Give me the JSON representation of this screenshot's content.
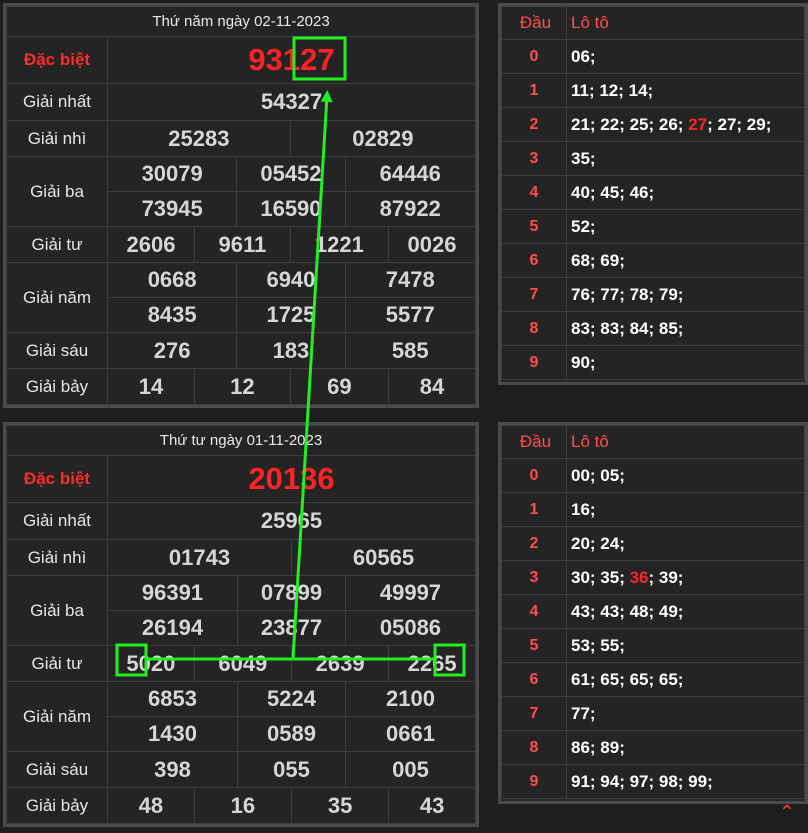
{
  "labels": {
    "special": "Đặc biệt",
    "first": "Giải nhất",
    "second": "Giải nhì",
    "third": "Giải ba",
    "fourth": "Giải tư",
    "fifth": "Giải năm",
    "sixth": "Giải sáu",
    "seventh": "Giải bảy",
    "dau": "Đầu",
    "loto": "Lô tô"
  },
  "draws": [
    {
      "date": "Thứ năm ngày 02-11-2023",
      "special": "93127",
      "first": "54327",
      "second": [
        "25283",
        "02829"
      ],
      "third": [
        "30079",
        "05452",
        "64446",
        "73945",
        "16590",
        "87922"
      ],
      "fourth": [
        "2606",
        "9611",
        "1221",
        "0026"
      ],
      "fifth": [
        "0668",
        "6940",
        "7478",
        "8435",
        "1725",
        "5577"
      ],
      "sixth": [
        "276",
        "183",
        "585"
      ],
      "seventh": [
        "14",
        "12",
        "69",
        "84"
      ],
      "loto": [
        {
          "d": "0",
          "l": "06;"
        },
        {
          "d": "1",
          "l": "11; 12; 14;"
        },
        {
          "d": "2",
          "a": "21; 22; 25; 26; ",
          "h": "27",
          "b": "; 27; 29;"
        },
        {
          "d": "3",
          "l": "35;"
        },
        {
          "d": "4",
          "l": "40; 45; 46;"
        },
        {
          "d": "5",
          "l": "52;"
        },
        {
          "d": "6",
          "l": "68; 69;"
        },
        {
          "d": "7",
          "l": "76; 77; 78; 79;"
        },
        {
          "d": "8",
          "l": "83; 83; 84; 85;"
        },
        {
          "d": "9",
          "l": "90;"
        }
      ]
    },
    {
      "date": "Thứ tư ngày 01-11-2023",
      "special": "20136",
      "first": "25965",
      "second": [
        "01743",
        "60565"
      ],
      "third": [
        "96391",
        "07899",
        "49997",
        "26194",
        "23877",
        "05086"
      ],
      "fourth": [
        "5020",
        "6049",
        "2639",
        "2265"
      ],
      "fifth": [
        "6853",
        "5224",
        "2100",
        "1430",
        "0589",
        "0661"
      ],
      "sixth": [
        "398",
        "055",
        "005"
      ],
      "seventh": [
        "48",
        "16",
        "35",
        "43"
      ],
      "loto": [
        {
          "d": "0",
          "l": "00; 05;"
        },
        {
          "d": "1",
          "l": "16;"
        },
        {
          "d": "2",
          "l": "20; 24;"
        },
        {
          "d": "3",
          "a": "30; 35; ",
          "h": "36",
          "b": "; 39;"
        },
        {
          "d": "4",
          "l": "43; 43; 48; 49;"
        },
        {
          "d": "5",
          "l": "53; 55;"
        },
        {
          "d": "6",
          "l": "61; 65; 65; 65;"
        },
        {
          "d": "7",
          "l": "77;"
        },
        {
          "d": "8",
          "l": "86; 89;"
        },
        {
          "d": "9",
          "l": "91; 94; 97; 98; 99;"
        }
      ]
    }
  ],
  "scroll_up_icon": "chevron-up-icon",
  "annotation_color": "#22ee22"
}
